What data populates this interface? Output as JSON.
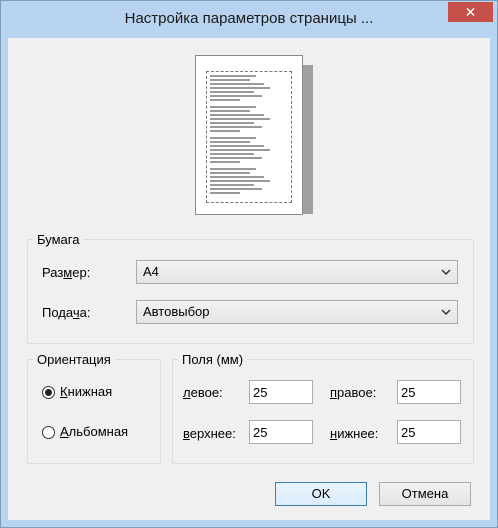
{
  "window": {
    "title": "Настройка параметров страницы ...",
    "close_glyph": "✕"
  },
  "paper": {
    "legend": "Бумага",
    "size_label_pre": "Раз",
    "size_label_u": "м",
    "size_label_post": "ер:",
    "size_value": "A4",
    "source_label_pre": "Пода",
    "source_label_u": "ч",
    "source_label_post": "а:",
    "source_value": "Автовыбор"
  },
  "orientation": {
    "legend": "Ориентация",
    "portrait_u": "К",
    "portrait_rest": "нижная",
    "landscape_u": "А",
    "landscape_rest": "льбомная",
    "selected": "portrait"
  },
  "margins": {
    "legend": "Поля (мм)",
    "left_u": "л",
    "left_rest": "евое:",
    "left_value": "25",
    "right_u": "п",
    "right_rest": "равое:",
    "right_value": "25",
    "top_u": "в",
    "top_rest": "ерхнее:",
    "top_value": "25",
    "bottom_u": "н",
    "bottom_rest": "ижнее:",
    "bottom_value": "25"
  },
  "buttons": {
    "ok": "OK",
    "cancel": "Отмена"
  },
  "icons": {
    "chevron": "chevron-down-icon",
    "close": "close-icon"
  },
  "colors": {
    "close_bg": "#c7504b",
    "titlebar": "#b8d3f0",
    "default_button_border": "#3c7fb1"
  }
}
